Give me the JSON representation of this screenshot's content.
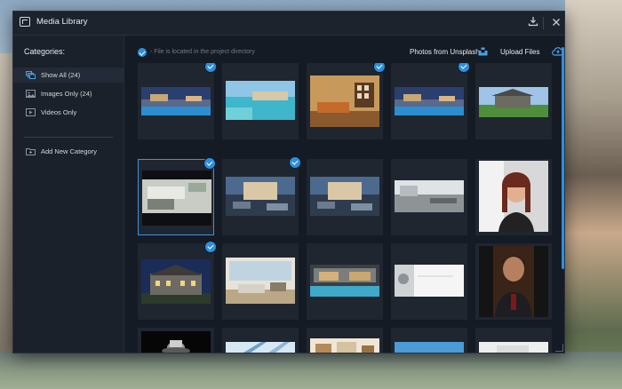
{
  "window": {
    "title": "Media Library"
  },
  "sidebar": {
    "heading": "Categories:",
    "items": [
      {
        "label": "Show All (24)",
        "icon": "stack-icon",
        "active": true
      },
      {
        "label": "Images Only (24)",
        "icon": "image-icon",
        "active": false
      },
      {
        "label": "Videos Only",
        "icon": "video-icon",
        "active": false
      }
    ],
    "add_label": "Add New Category"
  },
  "header": {
    "note": "- File is located in the project directory",
    "unsplash_label": "Photos from Unsplash",
    "upload_label": "Upload Files"
  },
  "colors": {
    "accent": "#2b90e0",
    "panel": "#151b24",
    "sidebar": "#1a212b",
    "tile": "#1f2630"
  },
  "grid": {
    "tiles": [
      {
        "desc": "pool-night",
        "checked": true,
        "selected": false
      },
      {
        "desc": "coastal-town",
        "checked": false,
        "selected": false
      },
      {
        "desc": "living-room",
        "checked": true,
        "selected": false
      },
      {
        "desc": "pool-night-2",
        "checked": true,
        "selected": false
      },
      {
        "desc": "house-lawn",
        "checked": false,
        "selected": false
      },
      {
        "desc": "modern-house",
        "checked": true,
        "selected": true
      },
      {
        "desc": "patio-dusk",
        "checked": true,
        "selected": false
      },
      {
        "desc": "patio-dusk-2",
        "checked": false,
        "selected": false
      },
      {
        "desc": "rooftop-terrace",
        "checked": false,
        "selected": false
      },
      {
        "desc": "woman-portrait",
        "checked": false,
        "selected": false
      },
      {
        "desc": "mansion-night",
        "checked": true,
        "selected": false
      },
      {
        "desc": "bright-living",
        "checked": false,
        "selected": false
      },
      {
        "desc": "villa-pool",
        "checked": false,
        "selected": false
      },
      {
        "desc": "white-interior",
        "checked": false,
        "selected": false
      },
      {
        "desc": "man-portrait",
        "checked": false,
        "selected": false
      },
      {
        "desc": "hat-dark",
        "checked": false,
        "selected": false
      },
      {
        "desc": "glass-ceiling",
        "checked": false,
        "selected": false
      },
      {
        "desc": "wood-interior",
        "checked": false,
        "selected": false
      },
      {
        "desc": "blue-sky",
        "checked": false,
        "selected": false
      },
      {
        "desc": "white-room",
        "checked": false,
        "selected": false
      }
    ]
  }
}
